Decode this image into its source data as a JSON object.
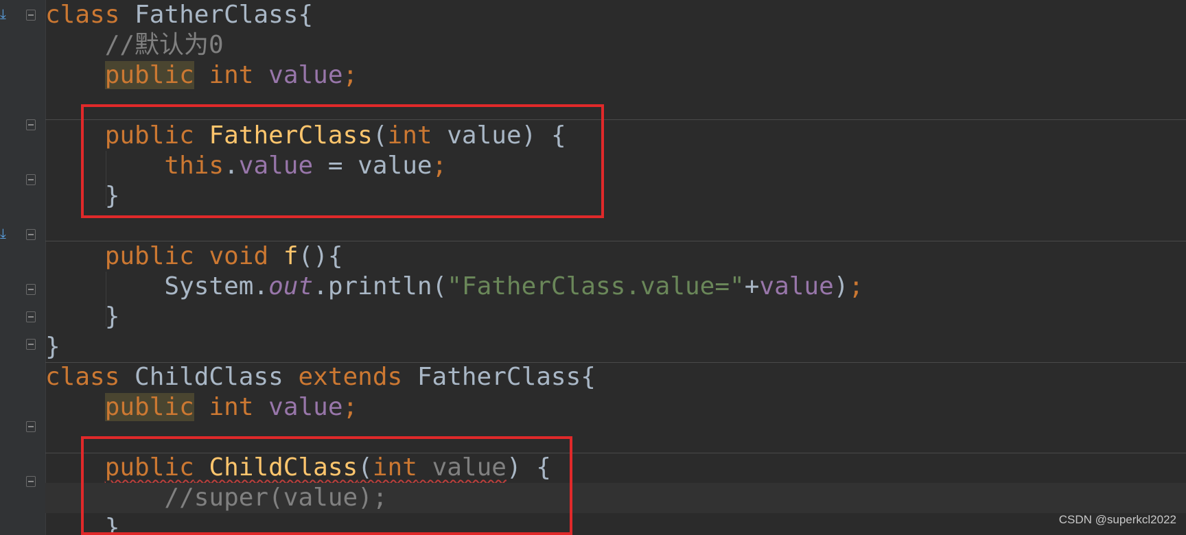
{
  "editor": {
    "lines": [
      {
        "tokens": [
          {
            "t": "class",
            "c": "kw"
          },
          {
            "t": " ",
            "c": "plain"
          },
          {
            "t": "FatherClass",
            "c": "cls"
          },
          {
            "t": "{",
            "c": "plain"
          }
        ]
      },
      {
        "tokens": [
          {
            "t": "    //默认为0",
            "c": "comment"
          }
        ]
      },
      {
        "tokens": [
          {
            "t": "    ",
            "c": "plain"
          },
          {
            "t": "public",
            "c": "kw-hl"
          },
          {
            "t": " ",
            "c": "plain"
          },
          {
            "t": "int",
            "c": "kw"
          },
          {
            "t": " ",
            "c": "plain"
          },
          {
            "t": "value",
            "c": "field"
          },
          {
            "t": ";",
            "c": "kw"
          }
        ]
      },
      {
        "tokens": []
      },
      {
        "tokens": [
          {
            "t": "    ",
            "c": "plain"
          },
          {
            "t": "public",
            "c": "kw"
          },
          {
            "t": " ",
            "c": "plain"
          },
          {
            "t": "FatherClass",
            "c": "method"
          },
          {
            "t": "(",
            "c": "plain"
          },
          {
            "t": "int",
            "c": "kw"
          },
          {
            "t": " value) {",
            "c": "plain"
          }
        ]
      },
      {
        "tokens": [
          {
            "t": "        ",
            "c": "plain"
          },
          {
            "t": "this",
            "c": "kw"
          },
          {
            "t": ".",
            "c": "plain"
          },
          {
            "t": "value",
            "c": "field"
          },
          {
            "t": " = value",
            "c": "plain"
          },
          {
            "t": ";",
            "c": "kw"
          }
        ]
      },
      {
        "tokens": [
          {
            "t": "    }",
            "c": "plain"
          }
        ]
      },
      {
        "tokens": []
      },
      {
        "tokens": [
          {
            "t": "    ",
            "c": "plain"
          },
          {
            "t": "public",
            "c": "kw"
          },
          {
            "t": " ",
            "c": "plain"
          },
          {
            "t": "void",
            "c": "kw"
          },
          {
            "t": " ",
            "c": "plain"
          },
          {
            "t": "f",
            "c": "method"
          },
          {
            "t": "(){",
            "c": "plain"
          }
        ]
      },
      {
        "tokens": [
          {
            "t": "        System.",
            "c": "plain"
          },
          {
            "t": "out",
            "c": "static-italic"
          },
          {
            "t": ".println(",
            "c": "plain"
          },
          {
            "t": "\"FatherClass.value=\"",
            "c": "str"
          },
          {
            "t": "+",
            "c": "plain"
          },
          {
            "t": "value",
            "c": "field"
          },
          {
            "t": ")",
            "c": "plain"
          },
          {
            "t": ";",
            "c": "kw"
          }
        ]
      },
      {
        "tokens": [
          {
            "t": "    }",
            "c": "plain"
          }
        ]
      },
      {
        "tokens": [
          {
            "t": "}",
            "c": "plain"
          }
        ]
      },
      {
        "tokens": [
          {
            "t": "class",
            "c": "kw"
          },
          {
            "t": " ChildClass ",
            "c": "plain"
          },
          {
            "t": "extends",
            "c": "kw"
          },
          {
            "t": " FatherClass{",
            "c": "plain"
          }
        ]
      },
      {
        "tokens": [
          {
            "t": "    ",
            "c": "plain"
          },
          {
            "t": "public",
            "c": "kw-hl"
          },
          {
            "t": " ",
            "c": "plain"
          },
          {
            "t": "int",
            "c": "kw"
          },
          {
            "t": " ",
            "c": "plain"
          },
          {
            "t": "value",
            "c": "field"
          },
          {
            "t": ";",
            "c": "kw"
          }
        ]
      },
      {
        "tokens": []
      },
      {
        "tokens": [
          {
            "t": "    ",
            "c": "plain"
          },
          {
            "t": "public",
            "c": "kw squiggle"
          },
          {
            "t": " ",
            "c": "plain squiggle"
          },
          {
            "t": "ChildClass",
            "c": "method squiggle"
          },
          {
            "t": "(",
            "c": "plain squiggle"
          },
          {
            "t": "int",
            "c": "kw squiggle"
          },
          {
            "t": " value",
            "c": "comment squiggle"
          },
          {
            "t": ") {",
            "c": "plain"
          }
        ]
      },
      {
        "tokens": [
          {
            "t": "        //super(value);",
            "c": "comment"
          }
        ]
      },
      {
        "tokens": [
          {
            "t": "    }",
            "c": "plain"
          }
        ]
      }
    ],
    "current_line": 16,
    "error_line": 15
  },
  "watermark": "CSDN @superkcl2022"
}
